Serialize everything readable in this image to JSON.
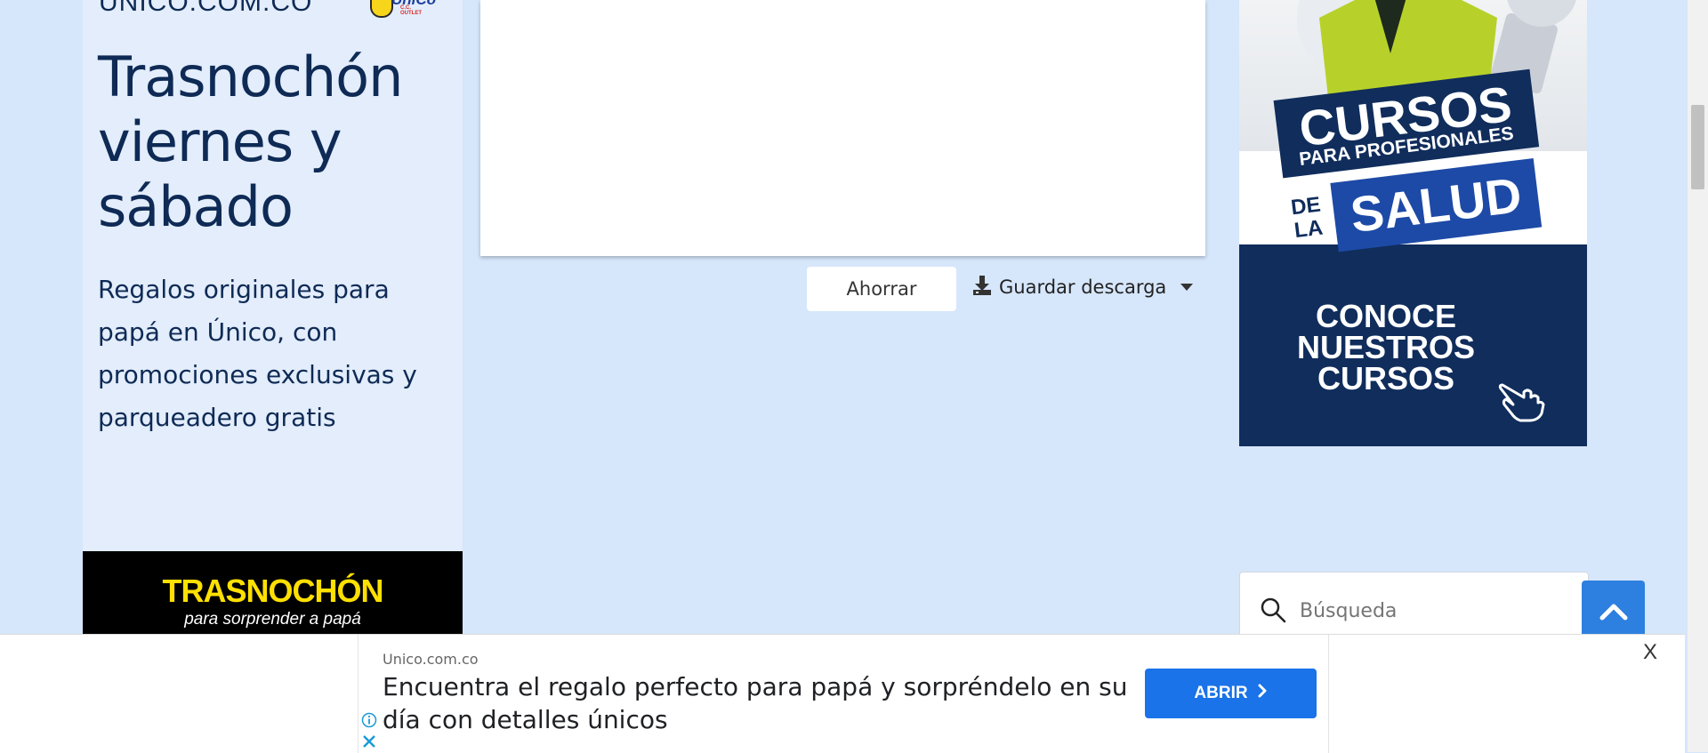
{
  "left_ad": {
    "domain": "UNICO.COM.CO",
    "logo_text": "ÚniCo",
    "logo_sub": "C.C. OUTLET",
    "headline": "Trasnochón viernes y sábado",
    "body": "Regalos originales para papá en Único, con promociones exclusivas y parqueadero gratis",
    "banner_title": "TRASNOCHÓN",
    "banner_subtitle": "para sorprender a papá"
  },
  "actions": {
    "save_label": "Ahorrar",
    "download_label": "Guardar descarga"
  },
  "right_ad": {
    "title_line1": "CURSOS",
    "title_line2": "PARA PROFESIONALES",
    "title_prefix": "DE LA",
    "title_line3": "SALUD",
    "cta": "CONOCE NUESTROS CURSOS"
  },
  "search": {
    "placeholder": "Búsqueda"
  },
  "bottom_ad": {
    "source": "Unico.com.co",
    "message": "Encuentra el regalo perfecto para papá y sorpréndelo en su día con detalles únicos",
    "button_label": "ABRIR",
    "close_label": "X"
  },
  "colors": {
    "page_bg": "#d6e6fb",
    "navy": "#0e2a55",
    "accent_blue": "#1a73e8",
    "banner_yellow": "#ffe000"
  }
}
